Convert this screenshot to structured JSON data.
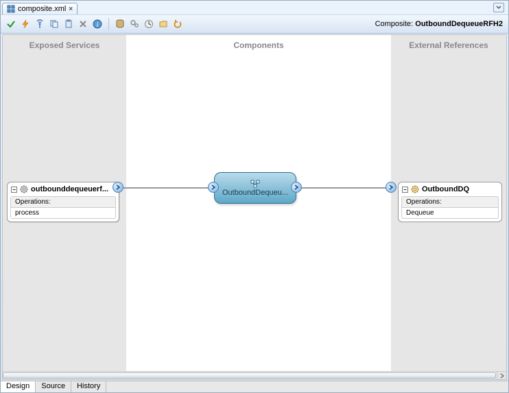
{
  "tab": {
    "title": "composite.xml",
    "close": "×"
  },
  "composite": {
    "label": "Composite:",
    "name": "OutboundDequeueRFH2"
  },
  "columns": {
    "left": "Exposed Services",
    "mid": "Components",
    "right": "External References"
  },
  "service": {
    "name": "outbounddequeuerf...",
    "ops_label": "Operations:",
    "op1": "process"
  },
  "component": {
    "name": "OutboundDequeu..."
  },
  "reference": {
    "name": "OutboundDQ",
    "ops_label": "Operations:",
    "op1": "Dequeue"
  },
  "bottom_tabs": {
    "t1": "Design",
    "t2": "Source",
    "t3": "History"
  },
  "icons": {
    "check": "check-icon",
    "bolt": "bolt-icon",
    "antenna": "antenna-icon",
    "copy": "copy-icon",
    "paste": "paste-icon",
    "delete": "delete-icon",
    "info": "info-icon",
    "db": "db-icon",
    "config": "config-icon",
    "clock": "clock-icon",
    "folder": "folder-icon",
    "undo": "undo-icon"
  }
}
